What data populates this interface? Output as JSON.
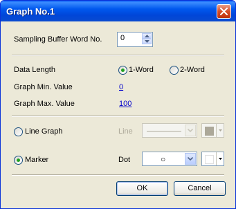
{
  "window": {
    "title": "Graph No.1"
  },
  "sampling": {
    "label": "Sampling Buffer Word No.",
    "value": "0"
  },
  "data_length": {
    "label": "Data Length",
    "options": [
      "1-Word",
      "2-Word"
    ],
    "selected": "1-Word"
  },
  "min_value": {
    "label": "Graph Min. Value",
    "value": "0"
  },
  "max_value": {
    "label": "Graph Max. Value",
    "value": "100"
  },
  "graph_type": {
    "line_graph_label": "Line Graph",
    "marker_label": "Marker",
    "selected": "Marker",
    "line_style_label": "Line",
    "marker_style_label": "Dot",
    "marker_value": "○",
    "line_color": "#aca899",
    "marker_color": "#ffffff"
  },
  "buttons": {
    "ok": "OK",
    "cancel": "Cancel"
  }
}
